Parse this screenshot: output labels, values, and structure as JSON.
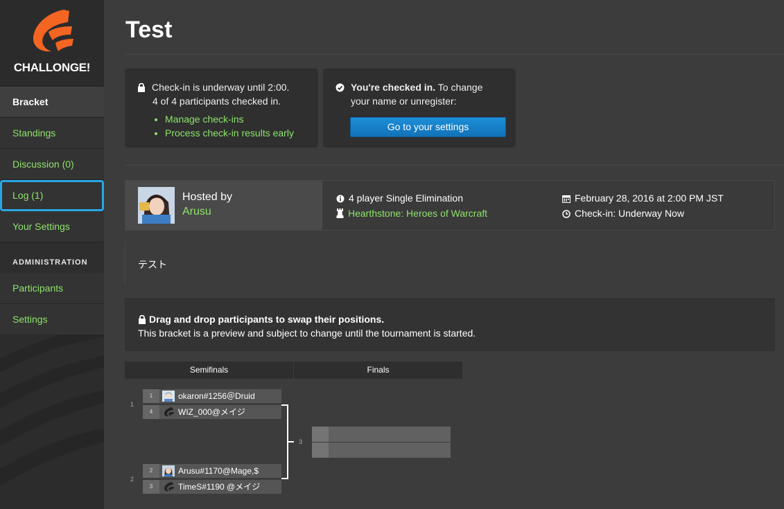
{
  "brand": {
    "name": "CHALLONGE!",
    "accent": "#f26522"
  },
  "sidebar": {
    "items": [
      {
        "label": "Bracket"
      },
      {
        "label": "Standings"
      },
      {
        "label": "Discussion (0)"
      },
      {
        "label": "Log (1)"
      },
      {
        "label": "Your Settings"
      }
    ],
    "admin_heading": "ADMINISTRATION",
    "admin_items": [
      {
        "label": "Participants"
      },
      {
        "label": "Settings"
      }
    ]
  },
  "page": {
    "title": "Test"
  },
  "checkin": {
    "line1": "Check-in is underway until 2:00.",
    "line2": "4 of 4 participants checked in.",
    "links": [
      "Manage check-ins",
      "Process check-in results early"
    ]
  },
  "checked_in": {
    "bold": "You're checked in.",
    "rest": " To change",
    "line2": "your name or unregister:",
    "button": "Go to your settings"
  },
  "host": {
    "hosted_by": "Hosted by",
    "name": "Arusu",
    "format": "4 player Single Elimination",
    "game": "Hearthstone: Heroes of Warcraft",
    "date": "February 28, 2016 at 2:00 PM JST",
    "checkin_status": "Check-in: Underway Now"
  },
  "description": "テスト",
  "notice": {
    "title": "Drag and drop participants to swap their positions.",
    "body": "This bracket is a preview and subject to change until the tournament is started."
  },
  "bracket": {
    "rounds": [
      "Semifinals",
      "Finals"
    ],
    "matches": [
      {
        "number": "1",
        "players": [
          {
            "seed": "1",
            "name": "okaron#1256＠Druid"
          },
          {
            "seed": "4",
            "name": "WIZ_000@メイジ"
          }
        ]
      },
      {
        "number": "2",
        "players": [
          {
            "seed": "2",
            "name": "Arusu#1170@Mage,$"
          },
          {
            "seed": "3",
            "name": "TimeS#1190 @メイジ"
          }
        ]
      }
    ],
    "final_number": "3"
  }
}
